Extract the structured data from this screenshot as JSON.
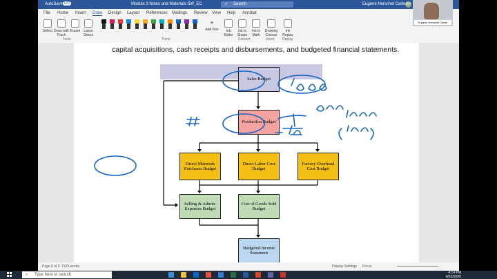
{
  "titlebar": {
    "autosave": "AutoSave",
    "autosave_state": "Off",
    "doc_title": "Module 3 Notes and Materials SW_EC",
    "search_placeholder": "Search",
    "user_name": "Eugene Herschel Carter",
    "user_initials": "EH"
  },
  "menu": [
    "File",
    "Home",
    "Insert",
    "Draw",
    "Design",
    "Layout",
    "References",
    "Mailings",
    "Review",
    "View",
    "Help",
    "Acrobat"
  ],
  "ribbon": {
    "tools": [
      "Select",
      "Draw with Touch",
      "Eraser",
      "Lasso Select"
    ],
    "tools_group": "Tools",
    "pens_group": "Pens",
    "pen_colors": [
      "#111111",
      "#d81b60",
      "#e53935",
      "#1e88e5",
      "#fdd835",
      "#f9a825",
      "#43a047",
      "#00acc1",
      "#fb8c00",
      "#1565c0",
      "#8e24aa",
      "#1565c0"
    ],
    "add_pen": "Add Pen",
    "convert": [
      "Ink to Shape",
      "Ink to Math"
    ],
    "ink_editor": "Ink Editor",
    "convert_group": "Convert",
    "drawing_canvas": "Drawing Canvas",
    "insert_group": "Insert",
    "ink_replay": "Ink Replay",
    "replay_group": "Replay"
  },
  "document": {
    "line1": "capital acquisitions, cash receipts and disbursements, and budgeted financial statements."
  },
  "diagram": {
    "sales": "Sales Budget",
    "production": "Production Budget",
    "dmp": "Direct Materials Purchases Budget",
    "dlc": "Direct Labor Cost Budget",
    "foh": "Factory Overhead Cost Budget",
    "sae": "Selling & Admin. Expenses Budget",
    "cogs": "Cost of Goods Sold Budget",
    "bis": "Budgeted Income Statement"
  },
  "status": {
    "page": "Page 6 of 9",
    "words": "2139 words",
    "display": "Display Settings",
    "focus": "Focus"
  },
  "taskbar": {
    "search_placeholder": "Type here to search",
    "time": "4:14 PM",
    "date": "9/22/2020"
  }
}
